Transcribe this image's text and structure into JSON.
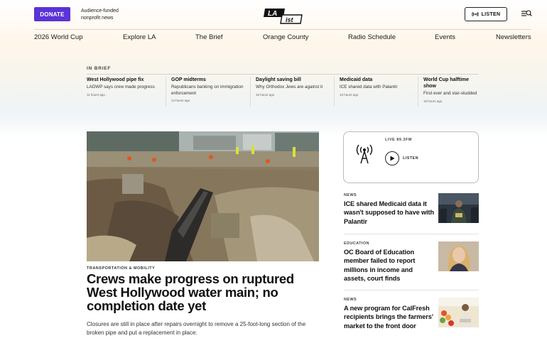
{
  "header": {
    "donate_label": "DONATE",
    "tagline_line1": "Audience-funded",
    "tagline_line2": "nonprofit news",
    "logo_text_top": "LA",
    "logo_text_bottom": "ist",
    "listen_label": "LISTEN",
    "accent_color": "#5b33d6"
  },
  "nav": {
    "items": [
      "2026 World Cup",
      "Explore LA",
      "The Brief",
      "Orange County",
      "Radio Schedule",
      "Events",
      "Newsletters"
    ]
  },
  "brief": {
    "label": "IN BRIEF",
    "items": [
      {
        "title": "West Hollywood pipe fix",
        "desc": "LADWP says crew made progress",
        "time": "11 hours ago"
      },
      {
        "title": "GOP midterms",
        "desc": "Republicans banking on immigration enforcement",
        "time": "14 hours ago"
      },
      {
        "title": "Daylight saving bill",
        "desc": "Why Orthodox Jews are against it",
        "time": "15 hours ago"
      },
      {
        "title": "Medicaid data",
        "desc": "ICE shared data with Palantir",
        "time": "15 hours ago"
      },
      {
        "title": "World Cup halftime show",
        "desc": "First ever and star-studded",
        "time": "16 hours ago"
      }
    ]
  },
  "hero": {
    "kicker": "TRANSPORTATION & MOBILITY",
    "headline": "Crews make progress on ruptured West Hollywood water main; no completion date yet",
    "dek": "Closures are still in place after repairs overnight to remove a 25-foot-long section of the broken pipe and put a replacement in place."
  },
  "live": {
    "label": "LIVE 89.3FM",
    "listen_label": "LISTEN"
  },
  "stories": [
    {
      "category": "NEWS",
      "title": "ICE shared Medicaid data it wasn't supposed to have with Palantir"
    },
    {
      "category": "EDUCATION",
      "title": "OC Board of Education member failed to report millions in income and assets, court finds"
    },
    {
      "category": "NEWS",
      "title": "A new program for CalFresh recipients brings the farmers' market to the front door"
    }
  ]
}
